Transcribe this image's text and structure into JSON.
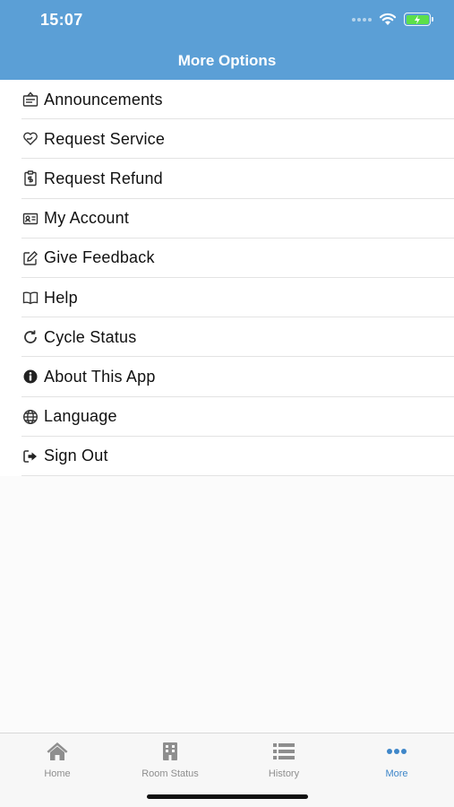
{
  "status_bar": {
    "time": "15:07"
  },
  "header": {
    "title": "More Options"
  },
  "menu": {
    "items": [
      {
        "label": "Announcements",
        "icon": "announcement-icon"
      },
      {
        "label": "Request Service",
        "icon": "service-icon"
      },
      {
        "label": "Request Refund",
        "icon": "refund-icon"
      },
      {
        "label": "My Account",
        "icon": "account-card-icon"
      },
      {
        "label": "Give Feedback",
        "icon": "edit-icon"
      },
      {
        "label": "Help",
        "icon": "book-icon"
      },
      {
        "label": "Cycle Status",
        "icon": "refresh-icon"
      },
      {
        "label": "About This App",
        "icon": "info-icon"
      },
      {
        "label": "Language",
        "icon": "globe-icon"
      },
      {
        "label": "Sign Out",
        "icon": "sign-out-icon"
      }
    ]
  },
  "tabbar": {
    "tabs": [
      {
        "label": "Home",
        "icon": "home-icon"
      },
      {
        "label": "Room Status",
        "icon": "building-icon"
      },
      {
        "label": "History",
        "icon": "list-icon"
      },
      {
        "label": "More",
        "icon": "more-dots-icon",
        "active": true
      }
    ]
  },
  "colors": {
    "header": "#5b9fd6",
    "accent": "#3f87c9",
    "battery": "#5ce04a"
  }
}
